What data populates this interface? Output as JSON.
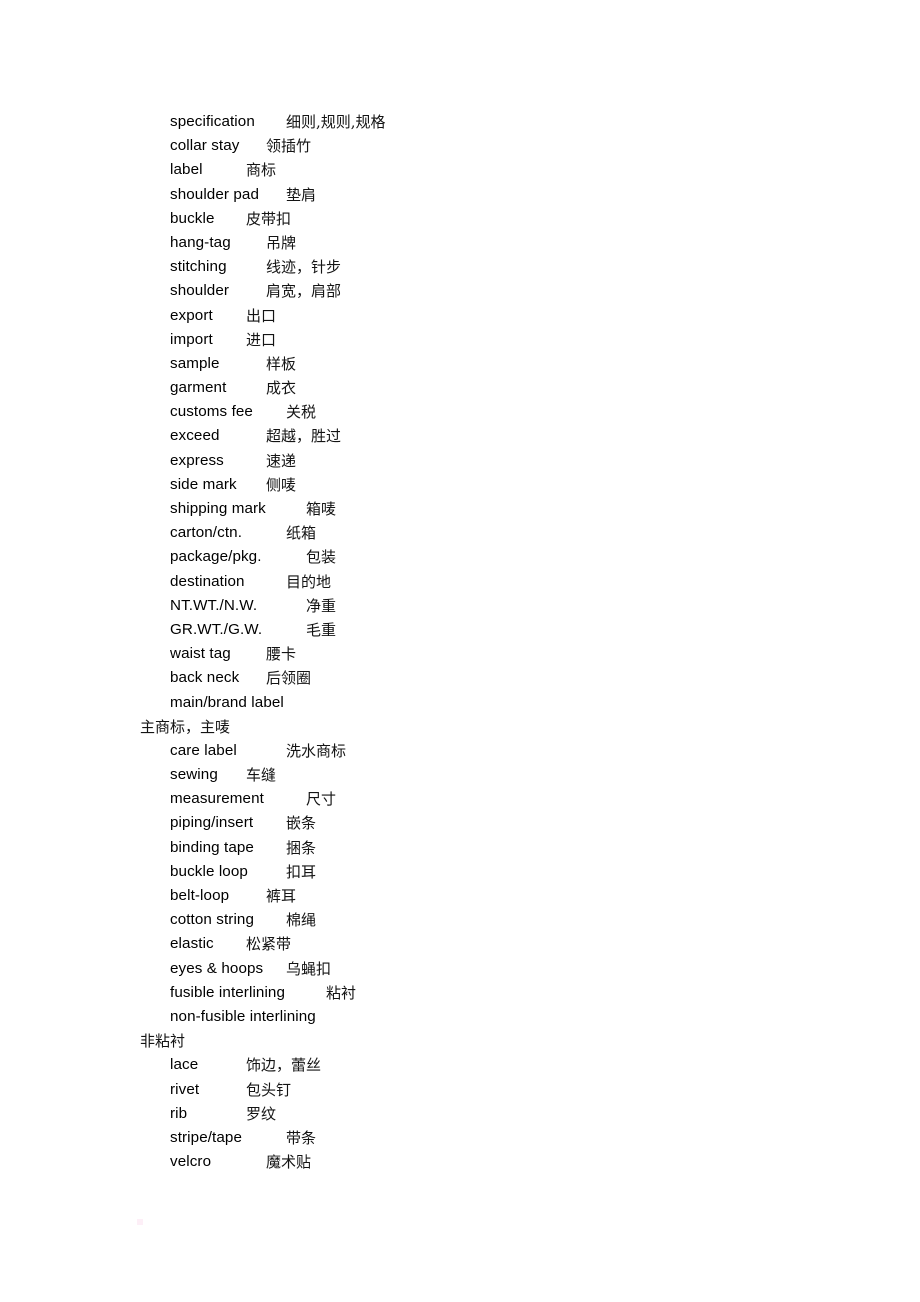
{
  "document": {
    "kind": "glossary-page",
    "language_pair": "English-Chinese",
    "page_background": "#ffffff",
    "text_color": "#000000"
  },
  "glossary": {
    "entries": [
      {
        "term": "specification",
        "translation": "细则,规则,规格",
        "tab": 3,
        "wrap": false
      },
      {
        "term": "collar stay",
        "translation": "领插竹",
        "tab": 2,
        "wrap": false
      },
      {
        "term": "label",
        "translation": "商标",
        "tab": 1,
        "wrap": false
      },
      {
        "term": "shoulder pad",
        "translation": "垫肩",
        "tab": 3,
        "wrap": false
      },
      {
        "term": "buckle",
        "translation": "皮带扣",
        "tab": 1,
        "wrap": false
      },
      {
        "term": "hang-tag",
        "translation": "吊牌",
        "tab": 2,
        "wrap": false
      },
      {
        "term": "stitching",
        "translation": "线迹，针步",
        "tab": 2,
        "wrap": false
      },
      {
        "term": "shoulder",
        "translation": "肩宽，肩部",
        "tab": 2,
        "wrap": false
      },
      {
        "term": "export",
        "translation": "出口",
        "tab": 1,
        "wrap": false
      },
      {
        "term": "import",
        "translation": "进口",
        "tab": 1,
        "wrap": false
      },
      {
        "term": "sample",
        "translation": "样板",
        "tab": 2,
        "wrap": false
      },
      {
        "term": "garment",
        "translation": "成衣",
        "tab": 2,
        "wrap": false
      },
      {
        "term": "customs fee",
        "translation": "关税",
        "tab": 3,
        "wrap": false
      },
      {
        "term": "exceed",
        "translation": "超越，胜过",
        "tab": 2,
        "wrap": false
      },
      {
        "term": "express",
        "translation": "速递",
        "tab": 2,
        "wrap": false
      },
      {
        "term": "side mark",
        "translation": "侧唛",
        "tab": 2,
        "wrap": false
      },
      {
        "term": "shipping mark",
        "translation": "箱唛",
        "tab": 4,
        "wrap": false
      },
      {
        "term": "carton/ctn.",
        "translation": "纸箱",
        "tab": 3,
        "wrap": false
      },
      {
        "term": "package/pkg.",
        "translation": "包装",
        "tab": 4,
        "wrap": false
      },
      {
        "term": "destination",
        "translation": "目的地",
        "tab": 3,
        "wrap": false
      },
      {
        "term": "NT.WT./N.W.",
        "translation": "净重",
        "tab": 4,
        "wrap": false
      },
      {
        "term": "GR.WT./G.W.",
        "translation": "毛重",
        "tab": 4,
        "wrap": false
      },
      {
        "term": "waist tag",
        "translation": "腰卡",
        "tab": 2,
        "wrap": false
      },
      {
        "term": "back neck",
        "translation": "后领圈",
        "tab": 2,
        "wrap": false
      },
      {
        "term": "main/brand label",
        "translation": "主商标，主唛",
        "tab": 0,
        "wrap": true
      },
      {
        "term": "care label",
        "translation": "洗水商标",
        "tab": 3,
        "wrap": false
      },
      {
        "term": "sewing",
        "translation": "车缝",
        "tab": 1,
        "wrap": false
      },
      {
        "term": "measurement",
        "translation": "尺寸",
        "tab": 4,
        "wrap": false
      },
      {
        "term": "piping/insert",
        "translation": "嵌条",
        "tab": 3,
        "wrap": false
      },
      {
        "term": "binding tape",
        "translation": "捆条",
        "tab": 3,
        "wrap": false
      },
      {
        "term": "buckle loop",
        "translation": "扣耳",
        "tab": 3,
        "wrap": false
      },
      {
        "term": "belt-loop",
        "translation": "裤耳",
        "tab": 2,
        "wrap": false
      },
      {
        "term": "cotton string",
        "translation": "棉绳",
        "tab": 3,
        "wrap": false
      },
      {
        "term": "elastic",
        "translation": "松紧带",
        "tab": 1,
        "wrap": false
      },
      {
        "term": "eyes & hoops",
        "translation": "乌蝇扣",
        "tab": 3,
        "wrap": false
      },
      {
        "term": "fusible interlining",
        "translation": "粘衬",
        "tab": 5,
        "wrap": false
      },
      {
        "term": "non-fusible interlining",
        "translation": "非粘衬",
        "tab": 0,
        "wrap": true
      },
      {
        "term": "lace",
        "translation": "饰边，蕾丝",
        "tab": 1,
        "wrap": false
      },
      {
        "term": "rivet",
        "translation": "包头钉",
        "tab": 1,
        "wrap": false
      },
      {
        "term": "rib",
        "translation": "罗纹",
        "tab": 1,
        "wrap": false
      },
      {
        "term": "stripe/tape",
        "translation": "带条",
        "tab": 3,
        "wrap": false
      },
      {
        "term": "velcro",
        "translation": "魔术贴",
        "tab": 2,
        "wrap": false
      }
    ]
  }
}
